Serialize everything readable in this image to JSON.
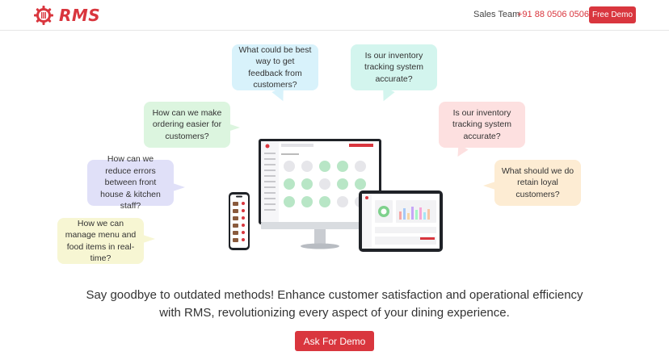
{
  "header": {
    "logo_text": "RMS",
    "sales_label": "Sales Team",
    "phone": "+91 88 0506 0506",
    "free_demo_label": "Free Demo"
  },
  "bubbles": [
    {
      "text": "What could be best way to get feedback from customers?"
    },
    {
      "text": "Is our inventory tracking system accurate?"
    },
    {
      "text": "How can we make ordering easier for customers?"
    },
    {
      "text": "Is our inventory tracking system accurate?"
    },
    {
      "text": "How can we reduce errors between front house & kitchen staff?"
    },
    {
      "text": "What should we do retain loyal customers?"
    },
    {
      "text": "How we can manage menu and food items in real-time?"
    }
  ],
  "hero": {
    "tagline": "Say goodbye to outdated methods! Enhance customer satisfaction and operational efficiency with RMS, revolutionizing every aspect of your dining experience.",
    "cta_label": "Ask For Demo"
  },
  "colors": {
    "brand": "#d9363e"
  }
}
